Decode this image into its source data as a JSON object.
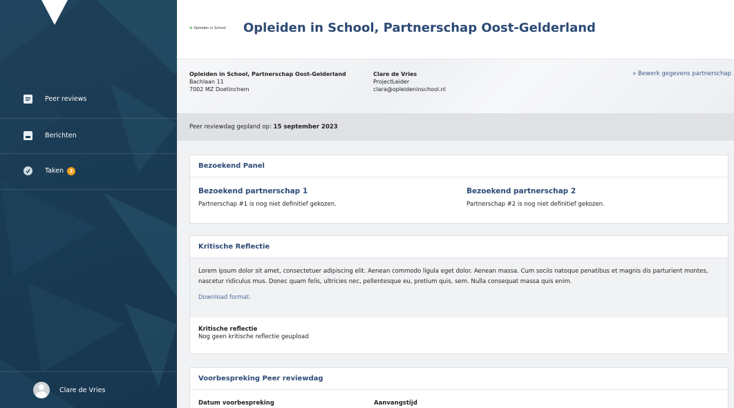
{
  "sidebar": {
    "items": [
      {
        "label": "Peer reviews",
        "icon": "document-icon"
      },
      {
        "label": "Berichten",
        "icon": "inbox-icon"
      },
      {
        "label": "Taken",
        "icon": "check-circle-icon",
        "badge": "3"
      }
    ],
    "user": {
      "name": "Clare de Vries"
    }
  },
  "header": {
    "brand_small": "Opleiden in School",
    "title": "Opleiden in School, Partnerschap Oost-Gelderland"
  },
  "info": {
    "org_name": "Opleiden in School, Partnerschap Oost-Gelderland",
    "street": "Bachlaan 11",
    "city": "7002 MZ Doetinchem",
    "contact_name": "Clare de Vries",
    "contact_role": "ProjectLeider",
    "contact_email": "clara@opleideninschool.nl",
    "edit_link": "» Bewerk gegevens partnerschap"
  },
  "schedule": {
    "label": "Peer reviewdag gepland op:",
    "date": "15 september 2023"
  },
  "panel": {
    "title": "Bezoekend Panel",
    "col1_heading": "Bezoekend partnerschap 1",
    "col1_text": "Partnerschap #1 is nog niet definitief gekozen.",
    "col2_heading": "Bezoekend partnerschap 2",
    "col2_text": "Partnerschap #2 is nog niet definitief gekozen."
  },
  "reflection": {
    "title": "Kritische Reflectie",
    "body": "Lorem ipsum dolor sit amet, consectetuer adipiscing elit. Aenean commodo ligula eget dolor. Aenean massa. Cum sociis natoque penatibus et magnis dis parturient montes, nascetur ridiculus mus. Donec quam felis, ultricies nec, pellentesque eu, pretium quis, sem. Nulla consequat massa quis enim.",
    "download_link": "Download format.",
    "sub_heading": "Kritische reflectie",
    "sub_text": "Nog geen kritische reflectie geupload"
  },
  "prep": {
    "title": "Voorbespreking Peer reviewdag",
    "col1_label": "Datum voorbespreking",
    "col2_label": "Aanvangstijd"
  },
  "colors": {
    "sidebar": "#1a3b54",
    "accent": "#2c4a75",
    "badge": "#f4a11c"
  }
}
